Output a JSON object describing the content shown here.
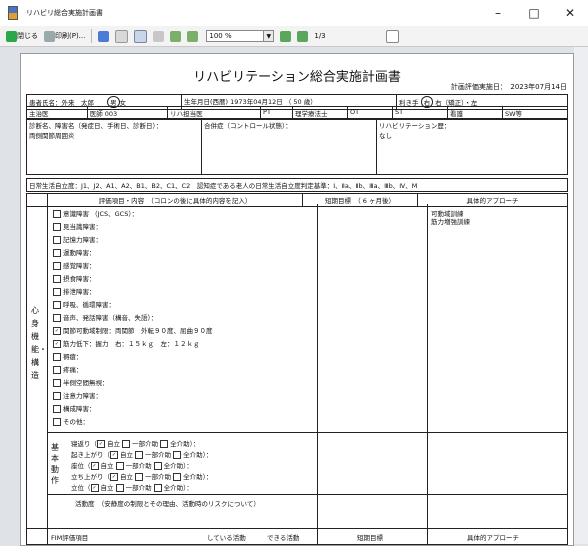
{
  "window": {
    "title": "リハビリ総合実施計画書",
    "btn_min": "–",
    "btn_max": "□",
    "btn_close": "✕"
  },
  "toolbar": {
    "close": "閉じる",
    "print": "印刷(P)...",
    "zoom": "100 %",
    "pages": "1/3"
  },
  "doc": {
    "title": "リハビリテーション総合実施計画書",
    "date_label": "計画評価実施日：",
    "date": "2023年07月14日",
    "patient_label": "患者氏名：",
    "patient_name": "外来　太郎",
    "gender_m": "男",
    "gender_f": "女",
    "dob_label": "生年月日(西暦)",
    "dob": "1973年04月12日",
    "age": "（ 50 歳）",
    "dominant_label": "利き手",
    "dominant": "右",
    "dominant_opts": "右（矯正）・左",
    "row2": {
      "a": "主治医",
      "b": "医師 003",
      "c": "リハ担当医",
      "d": "PT",
      "e": "理学療法士",
      "f": "OT",
      "g": "ST",
      "h": "看護",
      "i": "SW等"
    },
    "disease_label": "診断名、障害名（発症日、手術日、診断日）：",
    "disease": "両側関節周囲炎",
    "complication_label": "合併症（コントロール状態）：",
    "history_label": "リハビリテーション歴：",
    "history": "なし",
    "adl_label": "日常生活自立度：",
    "adl_opts": "J1、J2、A1、A2、B1、B2、C1、C2",
    "dementia_label": "認知症である老人の日常生活自立度判定基準：",
    "dementia_opts": "Ⅰ、Ⅱa、Ⅱb、Ⅲa、Ⅲb、Ⅳ、M",
    "h_eval": "評価項目・内容　（コロンの後に具体的内容を記入）",
    "h_short": "短期目標　（ 6 ヶ月後）",
    "h_approach": "具体的アプローチ",
    "approach_1": "可動域訓練",
    "approach_2": "筋力増強訓練",
    "side_label": "心身機能・構造",
    "items": [
      "意識障害 （JCS、GCS）：",
      "見当識障害：",
      "記憶力障害：",
      "運動障害：",
      "感覚障害：",
      "摂食障害：",
      "排泄障害：",
      "呼吸、循環障害：",
      "音声、発話障害（構音、失語）：",
      "関節可動域制限：両関節　外転９０度、屈曲９０度",
      "筋力低下：握力　右：１５ｋｇ　左：１２ｋｇ",
      "褥瘡：",
      "疼痛：",
      "半側空間無視：",
      "注意力障害：",
      "構成障害：",
      "その他："
    ],
    "basic_label": "基本動作",
    "basic": [
      "寝返り（",
      "起き上がり（",
      "座位（",
      "立ち上がり（",
      "立位（"
    ],
    "basic_opts": [
      "自立",
      "一部介助",
      "全介助）："
    ],
    "activity": "活動度　（安静度の制限とその理由、活動時のリスクについて）",
    "fim": "FIM評価項目",
    "doing": "している活動",
    "can": "できる活動",
    "short_goal": "短期目標",
    "approach": "具体的アプローチ"
  }
}
